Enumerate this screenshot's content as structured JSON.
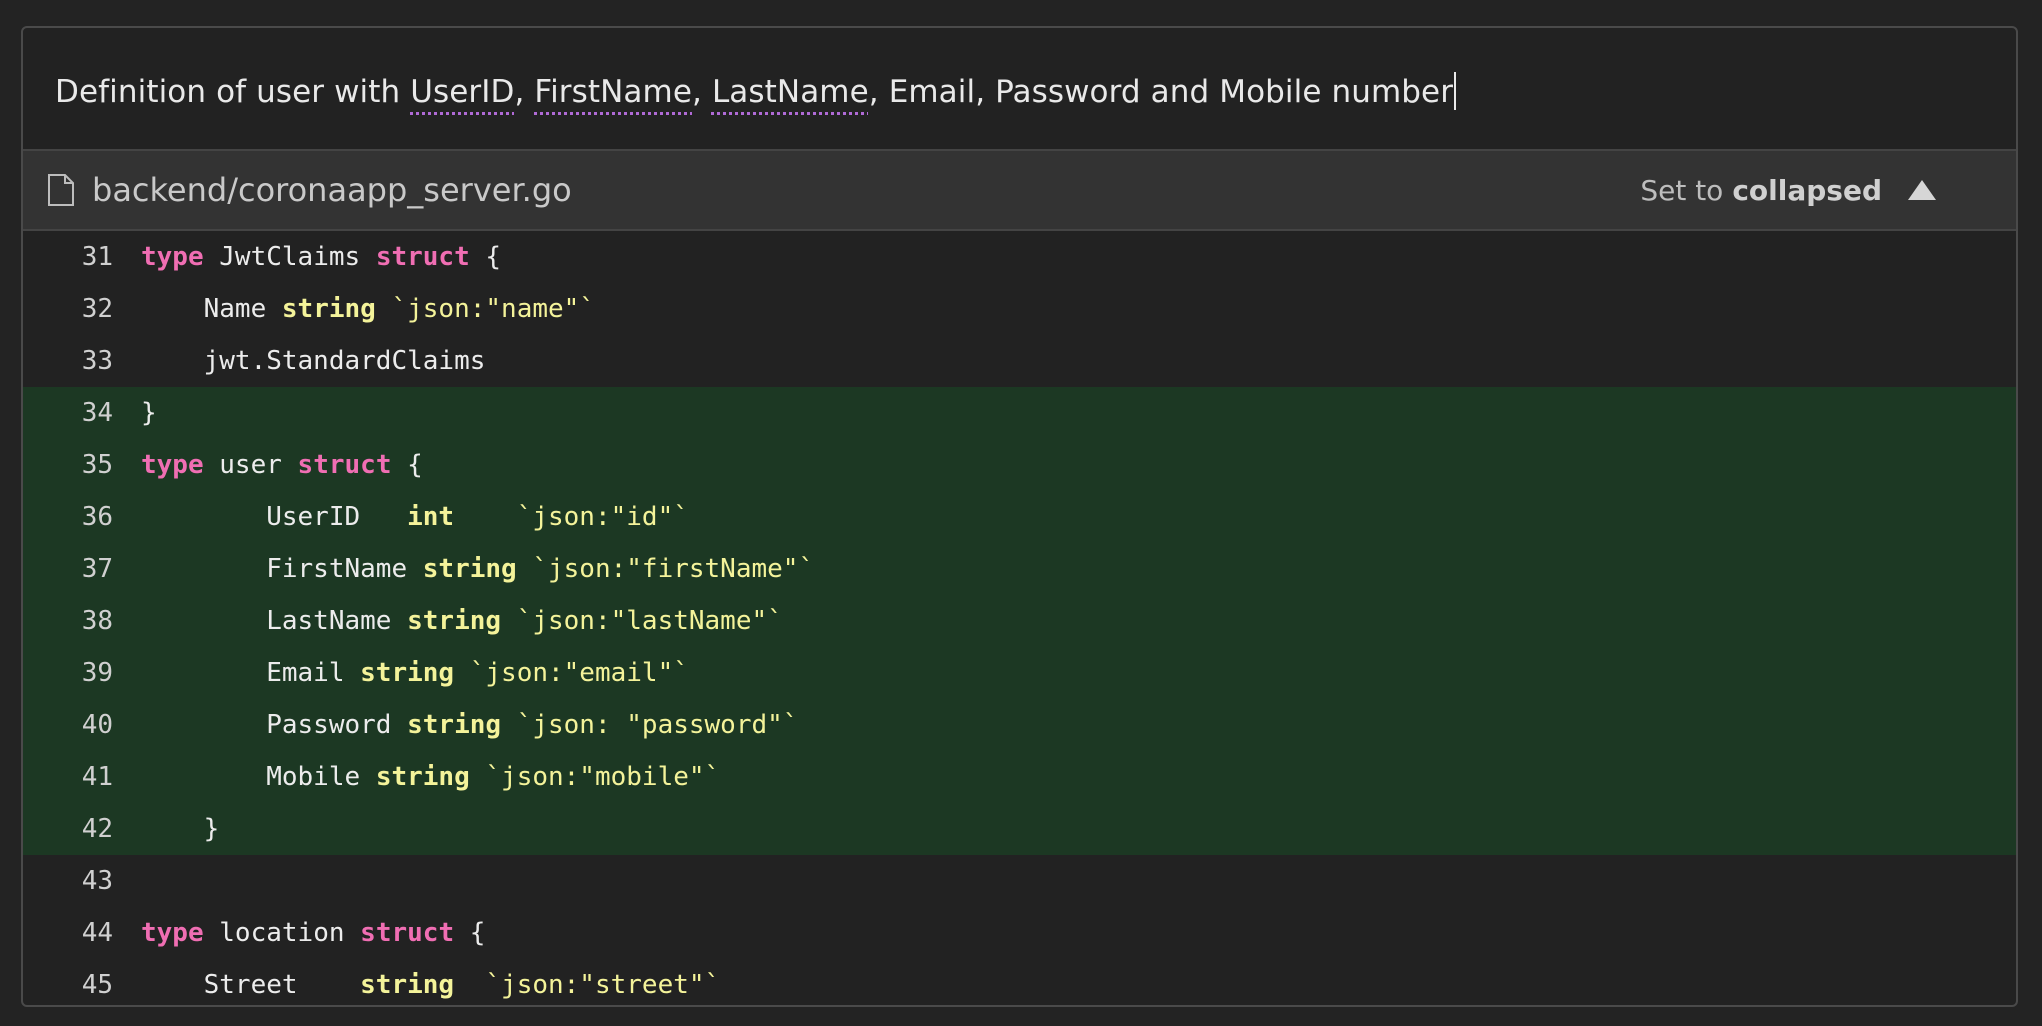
{
  "query": {
    "segments": [
      {
        "text": "Definition of user with ",
        "squiggle": false
      },
      {
        "text": "UserID",
        "squiggle": true
      },
      {
        "text": ", ",
        "squiggle": false
      },
      {
        "text": "FirstName",
        "squiggle": true
      },
      {
        "text": ", ",
        "squiggle": false
      },
      {
        "text": "LastName",
        "squiggle": true
      },
      {
        "text": ", Email, Password and Mobile number",
        "squiggle": false
      }
    ]
  },
  "file": {
    "icon": "file-icon",
    "path": "backend/coronaapp_server.go",
    "collapse_prefix": "Set to",
    "collapse_state": "collapsed",
    "collapse_icon": "triangle-up-icon"
  },
  "colors": {
    "keyword": "#f06eb3",
    "type": "#f4f39a",
    "highlight": "#1c3823"
  },
  "code_lines": [
    {
      "n": "31",
      "hl": false,
      "tokens": [
        [
          "kw",
          "type"
        ],
        [
          "p",
          " JwtClaims "
        ],
        [
          "kw",
          "struct"
        ],
        [
          "p",
          " {"
        ]
      ]
    },
    {
      "n": "32",
      "hl": false,
      "tokens": [
        [
          "p",
          "    Name "
        ],
        [
          "ty",
          "string"
        ],
        [
          "st",
          " `json:\"name\"`"
        ]
      ]
    },
    {
      "n": "33",
      "hl": false,
      "tokens": [
        [
          "p",
          "    jwt.StandardClaims"
        ]
      ]
    },
    {
      "n": "34",
      "hl": true,
      "tokens": [
        [
          "p",
          "}"
        ]
      ]
    },
    {
      "n": "35",
      "hl": true,
      "tokens": [
        [
          "kw",
          "type"
        ],
        [
          "p",
          " user "
        ],
        [
          "kw",
          "struct"
        ],
        [
          "p",
          " {"
        ]
      ]
    },
    {
      "n": "36",
      "hl": true,
      "tokens": [
        [
          "p",
          "        UserID   "
        ],
        [
          "ty",
          "int"
        ],
        [
          "st",
          "    `json:\"id\"`"
        ]
      ]
    },
    {
      "n": "37",
      "hl": true,
      "tokens": [
        [
          "p",
          "        FirstName "
        ],
        [
          "ty",
          "string"
        ],
        [
          "st",
          " `json:\"firstName\"`"
        ]
      ]
    },
    {
      "n": "38",
      "hl": true,
      "tokens": [
        [
          "p",
          "        LastName "
        ],
        [
          "ty",
          "string"
        ],
        [
          "st",
          " `json:\"lastName\"`"
        ]
      ]
    },
    {
      "n": "39",
      "hl": true,
      "tokens": [
        [
          "p",
          "        Email "
        ],
        [
          "ty",
          "string"
        ],
        [
          "st",
          " `json:\"email\"`"
        ]
      ]
    },
    {
      "n": "40",
      "hl": true,
      "tokens": [
        [
          "p",
          "        Password "
        ],
        [
          "ty",
          "string"
        ],
        [
          "st",
          " `json: \"password\"`"
        ]
      ]
    },
    {
      "n": "41",
      "hl": true,
      "tokens": [
        [
          "p",
          "        Mobile "
        ],
        [
          "ty",
          "string"
        ],
        [
          "st",
          " `json:\"mobile\"`"
        ]
      ]
    },
    {
      "n": "42",
      "hl": true,
      "tokens": [
        [
          "p",
          "    }"
        ]
      ]
    },
    {
      "n": "43",
      "hl": false,
      "tokens": []
    },
    {
      "n": "44",
      "hl": false,
      "tokens": [
        [
          "kw",
          "type"
        ],
        [
          "p",
          " location "
        ],
        [
          "kw",
          "struct"
        ],
        [
          "p",
          " {"
        ]
      ]
    },
    {
      "n": "45",
      "hl": false,
      "tokens": [
        [
          "p",
          "    Street    "
        ],
        [
          "ty",
          "string"
        ],
        [
          "st",
          "  `json:\"street\"`"
        ]
      ]
    }
  ]
}
